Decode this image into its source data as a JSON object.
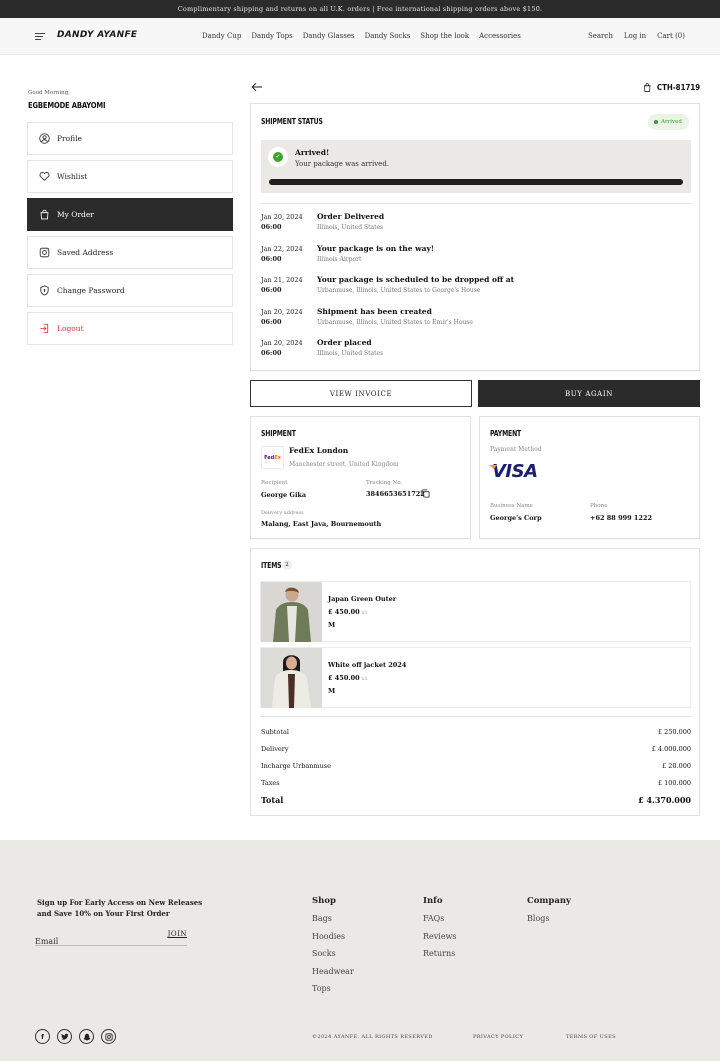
{
  "topbar": {
    "text": "Complimentary shipping and returns on all U.K. orders | Free international shipping orders above $150."
  },
  "nav": {
    "logo": "DANDY AYANFE",
    "links": [
      "Dandy Cup",
      "Dandy Tops",
      "Dandy Glasses",
      "Dandy Socks",
      "Shop the look",
      "Accessories"
    ],
    "search": "Search",
    "login": "Log in",
    "cart": "Cart (0)"
  },
  "account": {
    "greeting": "Good Morning,",
    "name": "EGBEMODE ABAYOMI",
    "menu": [
      {
        "label": "Profile",
        "icon": "profile-icon"
      },
      {
        "label": "Wishlist",
        "icon": "heart-icon"
      },
      {
        "label": "My Order",
        "icon": "bag-icon",
        "active": true
      },
      {
        "label": "Saved Address",
        "icon": "address-icon"
      },
      {
        "label": "Change Password",
        "icon": "lock-shield-icon"
      },
      {
        "label": "Logout",
        "icon": "logout-icon"
      }
    ]
  },
  "order": {
    "id": "CTH-81719",
    "shipment_status": {
      "title": "SHIPMENT STATUS",
      "badge": "Arrived",
      "banner_title": "Arrived!",
      "banner_text": "Your package was arrived.",
      "progress": 1.0
    },
    "timeline": [
      {
        "date": "Jan 20, 2024",
        "time": "06:00",
        "title": "Order Delivered",
        "sub": "Illinois, United States"
      },
      {
        "date": "Jan 22, 2024",
        "time": "06:00",
        "title": "Your package is on the way!",
        "sub": "Illinois Airport"
      },
      {
        "date": "Jan 21, 2024",
        "time": "06:00",
        "title": "Your package is scheduled to be dropped off at",
        "sub": "Urbanmuse, Illinois, United States to George's House"
      },
      {
        "date": "Jan 20, 2024",
        "time": "06:00",
        "title": "Shipment has been created",
        "sub": "Urbanmuse, Illinois, United States to Emir's House"
      },
      {
        "date": "Jan 20, 2024",
        "time": "06:00",
        "title": "Order placed",
        "sub": "Illinois, United States"
      }
    ],
    "buttons": {
      "invoice": "VIEW INVOICE",
      "buy_again": "BUY AGAIN"
    },
    "shipment": {
      "title": "SHIPMENT",
      "courier": "FedEx London",
      "courier_address": "Manchester street, United Kingdom",
      "recipient_label": "Recipient",
      "recipient": "George Gika",
      "tracking_label": "Tracking No.",
      "tracking": "3846653651722",
      "delivery_label": "Delivery address",
      "delivery": "Malang, East Java, Bournemouth"
    },
    "payment": {
      "title": "PAYMENT",
      "method_label": "Payment Method",
      "method": "VISA",
      "business_label": "Business Name",
      "business": "George's Corp",
      "phone_label": "Phone",
      "phone": "+62 88 999 1222"
    },
    "items": {
      "title": "ITEMS",
      "count": "2",
      "list": [
        {
          "name": "Japan Green Outer",
          "price": "£ 450.00",
          "qty": "x1",
          "size": "M"
        },
        {
          "name": "White off jacket 2024",
          "price": "£ 450.00",
          "qty": "x1",
          "size": "M"
        }
      ],
      "summary": [
        {
          "label": "Subtotal",
          "value": "£ 250.000"
        },
        {
          "label": "Delivery",
          "value": "£ 4.000.000"
        },
        {
          "label": "Incharge Urbanmuse",
          "value": "£ 20.000"
        },
        {
          "label": "Taxes",
          "value": "£ 100.000"
        }
      ],
      "total_label": "Total",
      "total": "£ 4.370.000"
    }
  },
  "footer": {
    "signup_line1": "Sign up For Early Access on New Releases",
    "signup_line2": "and Save 10% on Your First Order",
    "email_placeholder": "Email",
    "join": "JOIN",
    "shop": {
      "title": "Shop",
      "links": [
        "Bags",
        "Hoodies",
        "Socks",
        "Headwear",
        "Tops"
      ]
    },
    "info": {
      "title": "Info",
      "links": [
        "FAQs",
        "Reviews",
        "Returns"
      ]
    },
    "company": {
      "title": "Company",
      "links": [
        "Blogs"
      ]
    },
    "copyright": "©2024 AYANFE. ALL RIGHTS RESERVED",
    "privacy": "PRIVACY POLICY",
    "terms": "TERMS OF USES"
  }
}
